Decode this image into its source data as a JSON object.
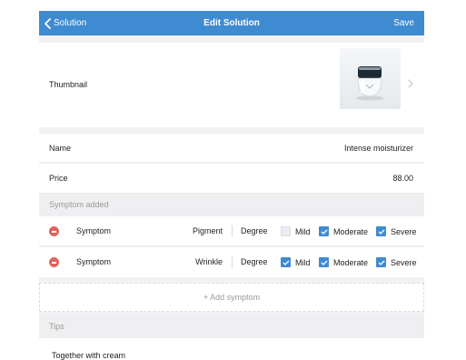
{
  "navbar": {
    "back_label": "Solution",
    "title": "Edit Solution",
    "save_label": "Save",
    "color": "#3f8bd1"
  },
  "thumbnail": {
    "label": "Thumbnail"
  },
  "fields": {
    "name_label": "Name",
    "name_value": "Intense moisturizer",
    "price_label": "Price",
    "price_value": "88.00"
  },
  "symptoms": {
    "section_title": "Symptom added",
    "degree_label": "Degree",
    "items": [
      {
        "label": "Symptom",
        "name": "Pigment",
        "options": [
          {
            "label": "Mild",
            "checked": false
          },
          {
            "label": "Moderate",
            "checked": true
          },
          {
            "label": "Severe",
            "checked": true
          }
        ]
      },
      {
        "label": "Symptom",
        "name": "Wrinkle",
        "options": [
          {
            "label": "Mild",
            "checked": true
          },
          {
            "label": "Moderate",
            "checked": true
          },
          {
            "label": "Severe",
            "checked": true
          }
        ]
      }
    ],
    "add_label": "+ Add symptom",
    "remove_color": "#e0645a"
  },
  "tips": {
    "section_title": "Tips",
    "text": "Together with cream"
  }
}
